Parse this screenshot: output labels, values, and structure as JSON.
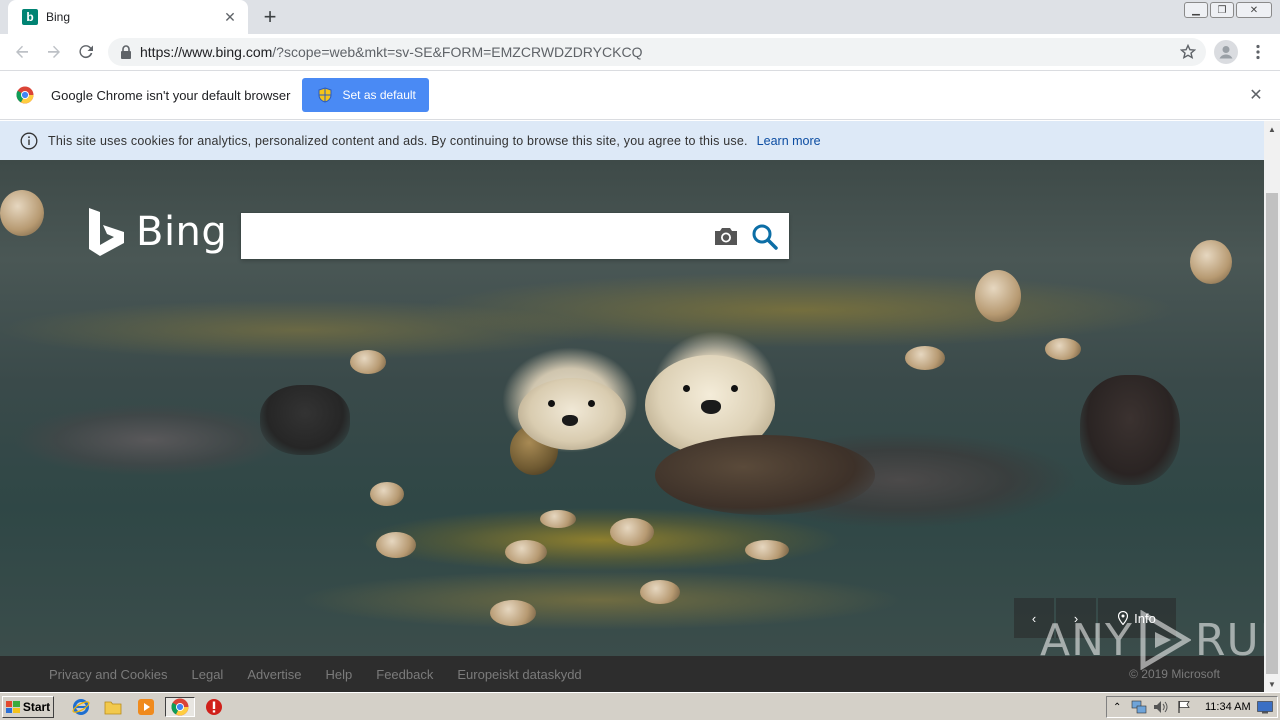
{
  "browser": {
    "tab": {
      "title": "Bing"
    },
    "new_tab_symbol": "+",
    "url": {
      "host": "https://www.bing.com",
      "path": "/?scope=web&mkt=sv-SE&FORM=EMZCRWDZDRYCKCQ"
    }
  },
  "infobar": {
    "message": "Google Chrome isn't your default browser",
    "button_label": "Set as default"
  },
  "cookie_banner": {
    "text": "This site uses cookies for analytics, personalized content and ads. By continuing to browse this site, you agree to this use.",
    "link": "Learn more"
  },
  "bing": {
    "logo_text": "Bing",
    "search": {
      "value": "",
      "placeholder": ""
    },
    "carousel": {
      "prev": "‹",
      "next": "›",
      "info_label": "Info"
    }
  },
  "footer": {
    "links": [
      "Privacy and Cookies",
      "Legal",
      "Advertise",
      "Help",
      "Feedback",
      "Europeiskt dataskydd"
    ],
    "copyright": "© 2019 Microsoft"
  },
  "watermark": {
    "left": "ANY",
    "right": "RUN"
  },
  "taskbar": {
    "start_label": "Start",
    "clock": "11:34 AM"
  },
  "colors": {
    "bing_teal": "#008373",
    "infobar_button": "#4a8af4",
    "cookie_bg": "#dde9f7",
    "footer_bg": "#2d2d2d",
    "taskbar_bg": "#d4d0c8"
  },
  "icons": [
    "bing-favicon",
    "tab-close-icon",
    "back-icon",
    "forward-icon",
    "reload-icon",
    "lock-icon",
    "star-icon",
    "profile-icon",
    "menu-icon",
    "chrome-logo-icon",
    "shield-icon",
    "close-icon",
    "info-icon",
    "bing-b-icon",
    "camera-icon",
    "search-icon",
    "location-pin-icon"
  ]
}
